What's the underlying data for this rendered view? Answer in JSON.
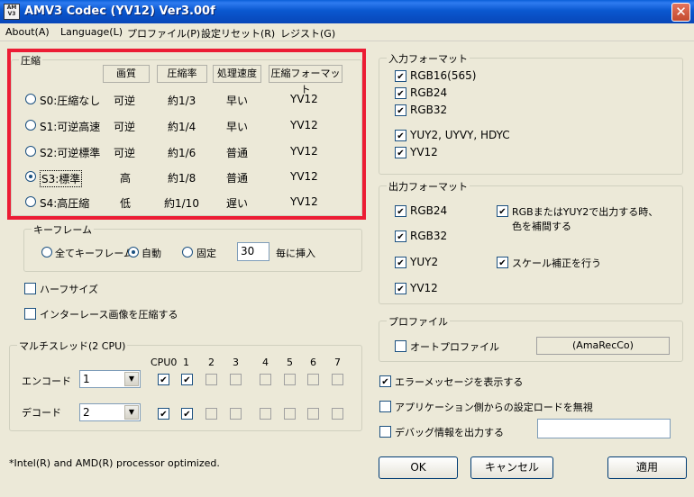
{
  "window": {
    "title": "AMV3 Codec (YV12) Ver3.00f",
    "icon_text": "AM V3",
    "close_glyph": "✕"
  },
  "menu": [
    "About(A)",
    "Language(L)",
    "プロファイル(P)",
    "設定リセット(R)",
    "レジスト(G)"
  ],
  "compress": {
    "group_title": "圧縮",
    "headers": [
      "画質",
      "圧縮率",
      "処理速度",
      "圧縮フォーマット"
    ],
    "rows": [
      {
        "label": "S0:圧縮なし",
        "quality": "可逆",
        "ratio": "約1/3",
        "speed": "早い",
        "format": "YV12",
        "selected": false
      },
      {
        "label": "S1:可逆高速",
        "quality": "可逆",
        "ratio": "約1/4",
        "speed": "早い",
        "format": "YV12",
        "selected": false
      },
      {
        "label": "S2:可逆標準",
        "quality": "可逆",
        "ratio": "約1/6",
        "speed": "普通",
        "format": "YV12",
        "selected": false
      },
      {
        "label": "S3:標準",
        "quality": "高",
        "ratio": "約1/8",
        "speed": "普通",
        "format": "YV12",
        "selected": true
      },
      {
        "label": "S4:高圧縮",
        "quality": "低",
        "ratio": "約1/10",
        "speed": "遅い",
        "format": "YV12",
        "selected": false
      }
    ]
  },
  "keyframe": {
    "group_title": "キーフレーム",
    "options": [
      "全てキーフレーム",
      "自動",
      "固定"
    ],
    "selected": "自動",
    "interval": "30",
    "suffix": "毎に挿入"
  },
  "options_left": [
    {
      "label": "ハーフサイズ",
      "checked": false
    },
    {
      "label": "インターレース画像を圧縮する",
      "checked": false
    }
  ],
  "multithread": {
    "group_title": "マルチスレッド(2 CPU)",
    "cpu_header": "CPU0",
    "cpu_numbers": [
      "1",
      "2",
      "3",
      "4",
      "5",
      "6",
      "7"
    ],
    "encode_label": "エンコード",
    "encode_value": "1",
    "decode_label": "デコード",
    "decode_value": "2",
    "combo_arrow": "▼"
  },
  "input_format": {
    "group_title": "入力フォーマット",
    "items": [
      {
        "label": "RGB16(565)",
        "checked": true
      },
      {
        "label": "RGB24",
        "checked": true
      },
      {
        "label": "RGB32",
        "checked": true
      },
      {
        "label": "YUY2, UYVY, HDYC",
        "checked": true
      },
      {
        "label": "YV12",
        "checked": true
      }
    ]
  },
  "output_format": {
    "group_title": "出力フォーマット",
    "items": [
      {
        "label": "RGB24",
        "checked": true
      },
      {
        "label": "RGB32",
        "checked": true
      },
      {
        "label": "YUY2",
        "checked": true
      },
      {
        "label": "YV12",
        "checked": true
      }
    ],
    "rgb_note_line1": "RGBまたはYUY2で出力する時、",
    "rgb_note_line2": "色を補間する",
    "scale_label": "スケール補正を行う"
  },
  "profile": {
    "group_title": "プロファイル",
    "auto_label": "オートプロファイル",
    "auto_checked": false,
    "profile_name": "(AmaRecCo)"
  },
  "misc": [
    {
      "label": "エラーメッセージを表示する",
      "checked": true
    },
    {
      "label": "アプリケーション側からの設定ロードを無視",
      "checked": false
    },
    {
      "label": "デバッグ情報を出力する",
      "checked": false
    }
  ],
  "footer_note": "*Intel(R) and AMD(R) processor optimized.",
  "buttons": {
    "ok": "OK",
    "cancel": "キャンセル",
    "apply": "適用"
  }
}
